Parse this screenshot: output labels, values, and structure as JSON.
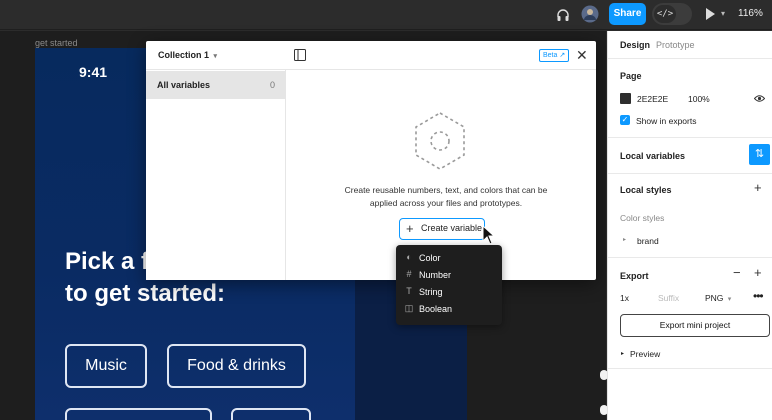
{
  "topbar": {
    "share_label": "Share",
    "code_icon_glyph": "</>",
    "zoom_label": "116%",
    "icons": [
      "headphones-icon",
      "avatar",
      "code-icon",
      "play-icon",
      "chevron-down-icon"
    ]
  },
  "canvas": {
    "frame_label": "get started",
    "phone": {
      "time": "9:41",
      "headline_line1": "Pick a f",
      "headline_line2": "to get started:",
      "pills": [
        "Music",
        "Food & drinks"
      ]
    }
  },
  "dialog": {
    "collection_title": "Collection 1",
    "all_variables_label": "All variables",
    "all_variables_count": "0",
    "beta_badge": "Beta",
    "empty_description_line1": "Create reusable numbers, text, and colors that can be",
    "empty_description_line2": "applied across your files and prototypes.",
    "create_variable_label": "Create variable",
    "menu_items": [
      {
        "label": "Color",
        "icon": "color-icon"
      },
      {
        "label": "Number",
        "icon": "number-icon"
      },
      {
        "label": "String",
        "icon": "string-icon"
      },
      {
        "label": "Boolean",
        "icon": "boolean-icon"
      }
    ]
  },
  "panel": {
    "tab_design": "Design",
    "tab_prototype": "Prototype",
    "page_title": "Page",
    "page_color_hex": "2E2E2E",
    "page_opacity": "100%",
    "show_in_exports": "Show in exports",
    "local_variables": "Local variables",
    "local_styles": "Local styles",
    "color_styles": "Color styles",
    "style_brand": "brand",
    "export_title": "Export",
    "export_scale": "1x",
    "export_suffix_placeholder": "Suffix",
    "export_format": "PNG",
    "export_button": "Export mini project",
    "preview_label": "Preview"
  },
  "colors": {
    "accent": "#0d99ff",
    "toolbar_bg": "#2c2c2c",
    "canvas_bg": "#1e1e1e",
    "phone_bg": "#072a5e",
    "page_swatch": "#2e2e2e"
  }
}
